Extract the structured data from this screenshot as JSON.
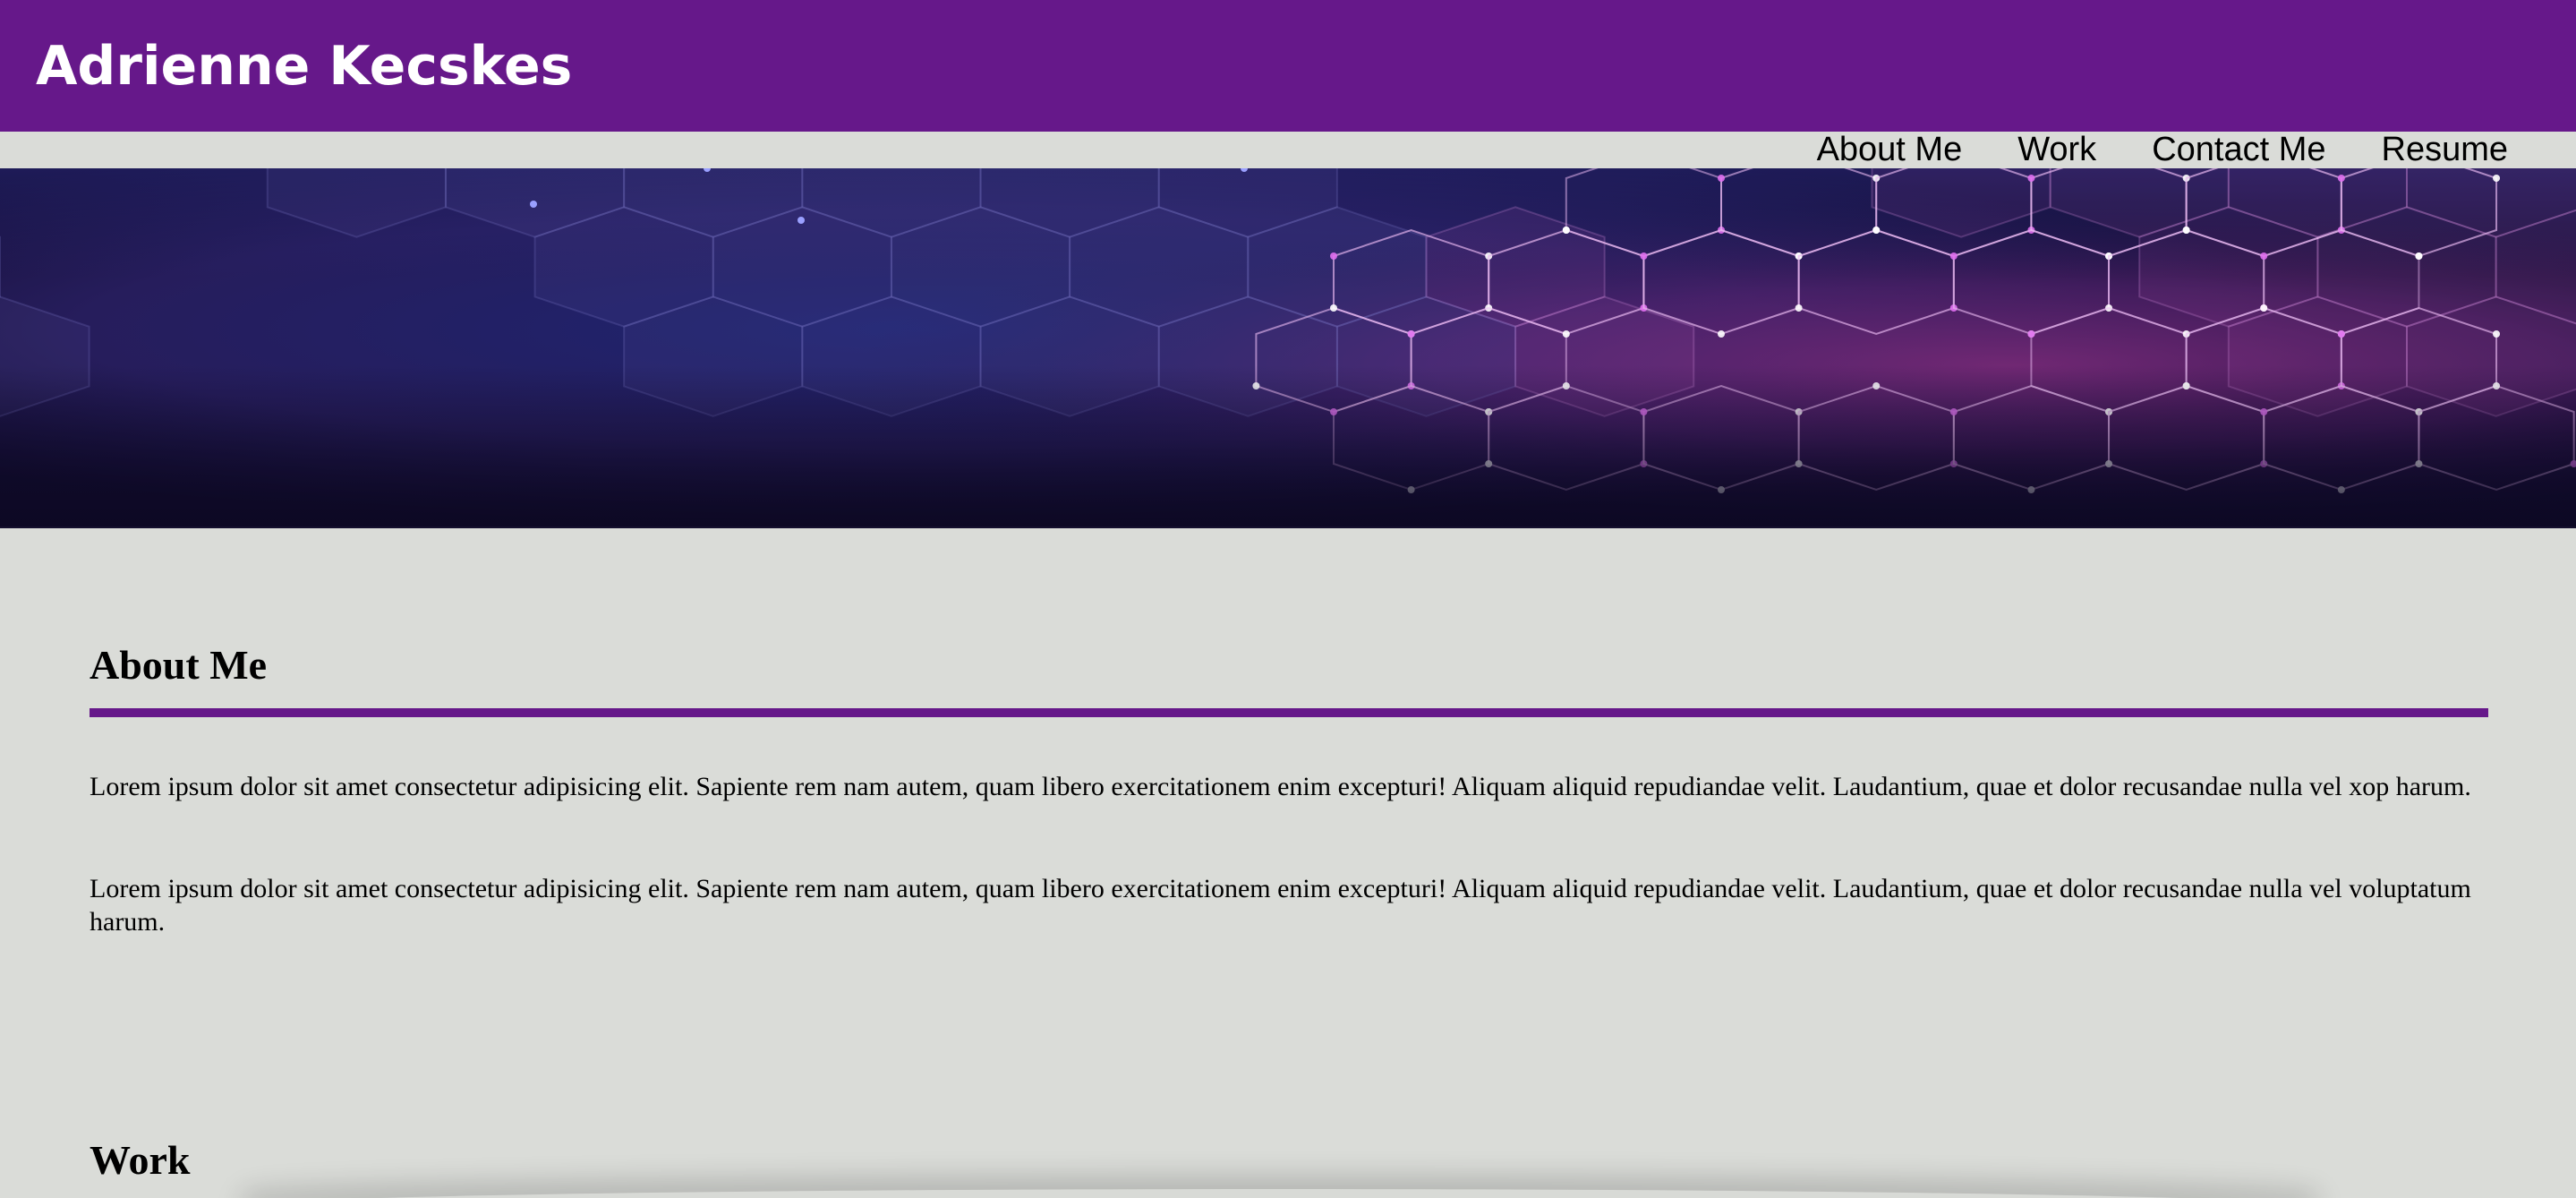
{
  "header": {
    "site_title": "Adrienne Kecskes",
    "background_color": "#66188a",
    "text_color": "#ffffff"
  },
  "nav": {
    "items": [
      {
        "label": "About Me"
      },
      {
        "label": "Work"
      },
      {
        "label": "Contact Me"
      },
      {
        "label": "Resume"
      }
    ]
  },
  "hero": {
    "image_description_icon": "hexagon-network-banner",
    "colors": [
      "#1c1f5e",
      "#3a1f6e",
      "#6b2a78",
      "#a04a9c"
    ]
  },
  "about": {
    "heading": "About Me",
    "divider_color": "#66188a",
    "paragraphs": [
      "Lorem ipsum dolor sit amet consectetur adipisicing elit. Sapiente rem nam autem, quam libero exercitationem enim excepturi! Aliquam aliquid repudiandae velit. Laudantium, quae et dolor recusandae nulla vel xop harum.",
      "Lorem ipsum dolor sit amet consectetur adipisicing elit. Sapiente rem nam autem, quam libero exercitationem enim excepturi! Aliquam aliquid repudiandae velit. Laudantium, quae et dolor recusandae nulla vel voluptatum harum."
    ]
  },
  "work": {
    "heading": "Work"
  },
  "page": {
    "background_color": "#dadcd8"
  }
}
